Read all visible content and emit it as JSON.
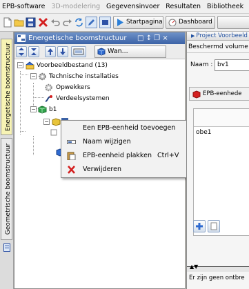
{
  "menubar": {
    "items": [
      {
        "label": "EPB-software",
        "disabled": false
      },
      {
        "label": "3D-modelering",
        "disabled": true
      },
      {
        "label": "Gegevensinvoer",
        "disabled": false
      },
      {
        "label": "Resultaten",
        "disabled": false
      },
      {
        "label": "Bibliotheek",
        "disabled": false
      }
    ]
  },
  "toolbar": {
    "startpagina_label": "Startpagina",
    "dashboard_label": "Dashboard"
  },
  "left_tabs": {
    "energetische": "Energetische boomstructuur",
    "geometrische": "Geometrische boomstructuur"
  },
  "panel": {
    "title": "Energetische boomstructuur",
    "controls": "□ ↕ ❐ ×",
    "wan_label": "Wan..."
  },
  "tree": {
    "root": "Voorbeeldbestand (13)",
    "technische": "Technische installaties",
    "opwekkers": "Opwekkers",
    "verdeelsystemen": "Verdeelsystemen",
    "b1": "b1"
  },
  "context_menu": {
    "add_epb": "Een EPB-eenheid toevoegen",
    "rename": "Naam wijzigen",
    "paste": "EPB-eenheid plakken",
    "paste_shortcut": "Ctrl+V",
    "delete": "Verwijderen"
  },
  "right_panel": {
    "title": "Project Voorbeeld",
    "beschermd": "Beschermd volume",
    "naam_label": "Naam :",
    "naam_value": "bv1",
    "epb_header": "EPB-eenhede",
    "list_item": "obe1",
    "status": "Er zijn geen ontbre"
  },
  "colors": {
    "title_bar": "#4a6fb0",
    "context_delete": "#d42020"
  }
}
